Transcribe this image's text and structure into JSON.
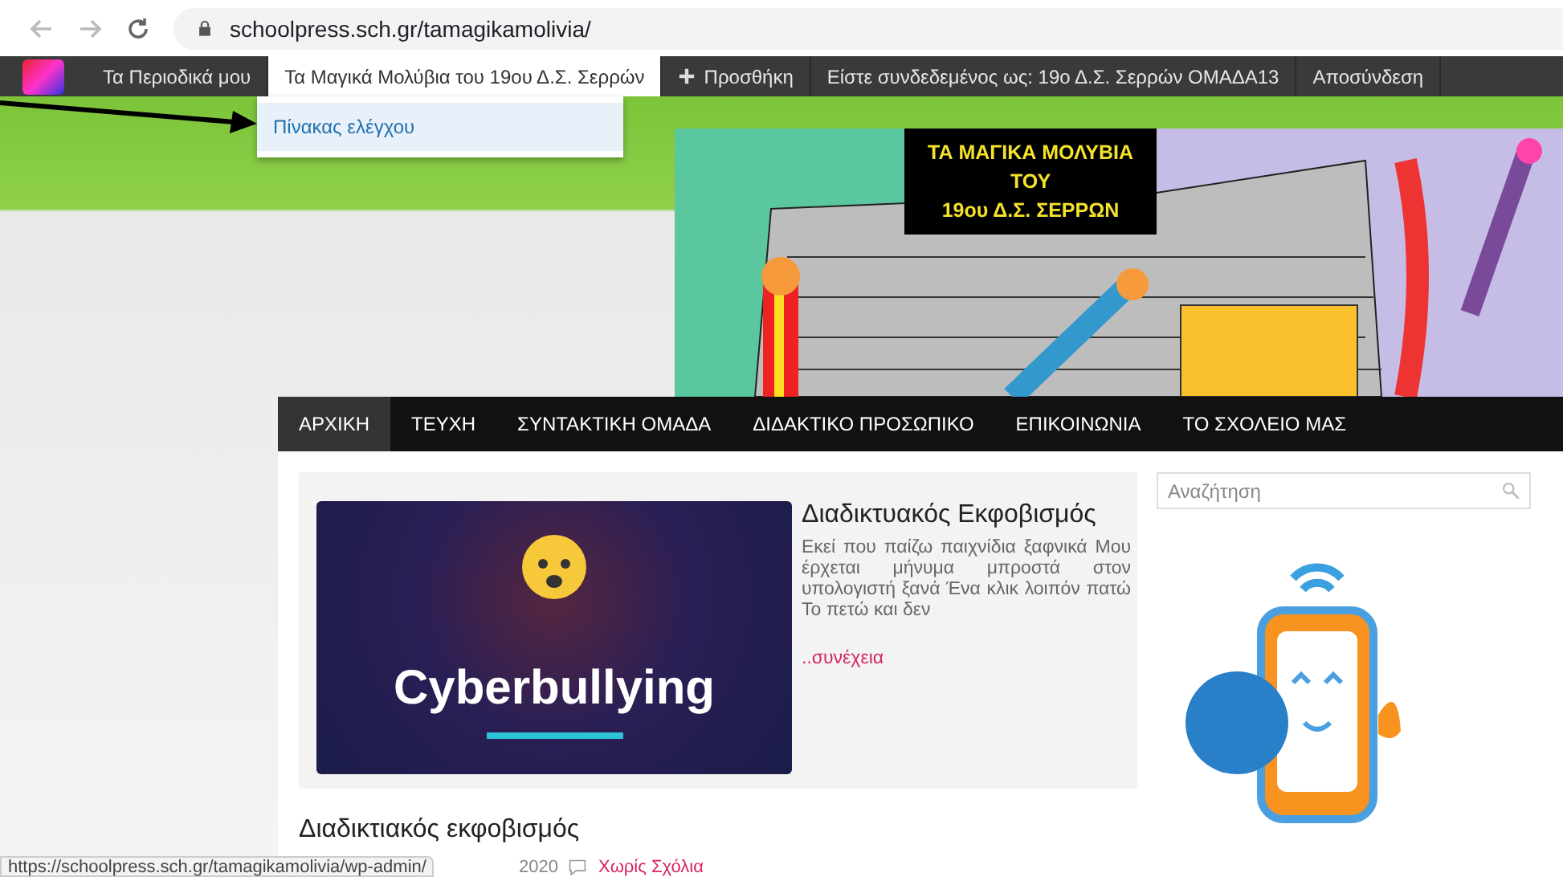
{
  "browser": {
    "url": "schoolpress.sch.gr/tamagikamolivia/"
  },
  "admin_bar": {
    "items": [
      {
        "kind": "menu",
        "label": "Τα Περιοδικά μου",
        "expanded": false
      },
      {
        "kind": "menu",
        "label": "Τα Μαγικά Μολύβια του 19ου Δ.Σ. Σερρών",
        "expanded": true
      },
      {
        "kind": "add",
        "label": "Προσθήκη",
        "expanded": false
      },
      {
        "kind": "menu",
        "label": "Είστε συνδεδεμένος ως: 19ο Δ.Σ. Σερρών ΟΜΑΔΑ13",
        "expanded": false
      },
      {
        "kind": "menu",
        "label": "Αποσύνδεση",
        "expanded": false
      }
    ],
    "dropdown": [
      {
        "label": "Πίνακας ελέγχου",
        "selected": true
      }
    ]
  },
  "banner": {
    "title_lines": [
      "ΤΑ ΜΑΓΙΚΑ ΜΟΛΥΒΙΑ",
      "ΤΟΥ",
      "19ου Δ.Σ. ΣΕΡΡΩΝ"
    ]
  },
  "nav": {
    "items": [
      {
        "label": "ΑΡΧΙΚΗ",
        "selected": true
      },
      {
        "label": "ΤΕΥΧΗ",
        "selected": false
      },
      {
        "label": "ΣΥΝΤΑΚΤΙΚΗ ΟΜΑΔΑ",
        "selected": false
      },
      {
        "label": "ΔΙΔΑΚΤΙΚΟ ΠΡΟΣΩΠΙΚΟ",
        "selected": false
      },
      {
        "label": "ΕΠΙΚΟΙΝΩΝΙΑ",
        "selected": false
      },
      {
        "label": "ΤΟ ΣΧΟΛΕΙΟ ΜΑΣ",
        "selected": false
      }
    ]
  },
  "search": {
    "placeholder": "Αναζήτηση"
  },
  "featured_post": {
    "image_text": "Cyberbullying",
    "title": "Διαδικτυακός Εκφοβισμός",
    "excerpt": "Εκεί που παίζω παιχνίδια ξαφνικά Μου έρχεται μήνυμα μπροστά στον υπολογιστή ξανά Ένα κλικ λοιπόν πατώ Το πετώ και δεν",
    "more": "..συνέχεια"
  },
  "post": {
    "title": "Διαδικτιακός εκφοβισμός",
    "date": "2020",
    "comments": "Χωρίς Σχόλια"
  },
  "status_url": "https://schoolpress.sch.gr/tamagikamolivia/wp-admin/"
}
